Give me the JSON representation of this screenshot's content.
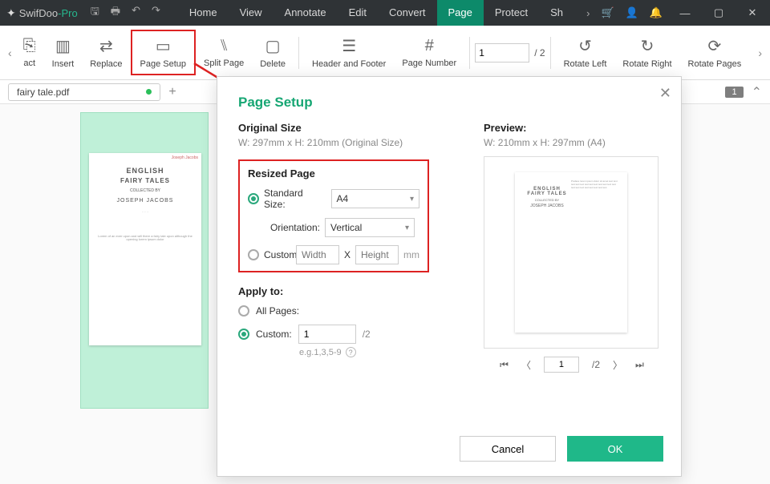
{
  "titlebar": {
    "brand1": "SwifDoo",
    "brand2": "-Pro"
  },
  "menu": {
    "home": "Home",
    "view": "View",
    "annotate": "Annotate",
    "edit": "Edit",
    "convert": "Convert",
    "page": "Page",
    "protect": "Protect",
    "share": "Sh"
  },
  "ribbon": {
    "extract": "act",
    "insert": "Insert",
    "replace": "Replace",
    "page_setup": "Page Setup",
    "split_page": "Split Page",
    "delete": "Delete",
    "hf": "Header and Footer",
    "page_number": "Page Number",
    "page_input": "1",
    "page_total": "/ 2",
    "rotate_left": "Rotate Left",
    "rotate_right": "Rotate Right",
    "rotate_pages": "Rotate Pages"
  },
  "tabs": {
    "file": "fairy tale.pdf",
    "badge": "1"
  },
  "thumb": {
    "t1": "ENGLISH",
    "t2": "FAIRY TALES",
    "t3": "COLLECTED BY",
    "t4": "JOSEPH JACOBS"
  },
  "dialog": {
    "title": "Page Setup",
    "orig_h": "Original Size",
    "orig_sub": "W: 297mm x H: 210mm (Original Size)",
    "resized_h": "Resized Page",
    "std_label": "Standard Size:",
    "std_value": "A4",
    "orient_label": "Orientation:",
    "orient_value": "Vertical",
    "custom_label": "Custom:",
    "w_ph": "Width",
    "x": "X",
    "h_ph": "Height",
    "mm": "mm",
    "apply_h": "Apply to:",
    "all_pages": "All Pages:",
    "custom_apply": "Custom:",
    "custom_val": "1",
    "custom_total": "/2",
    "hint": "e.g.1,3,5-9",
    "preview_h": "Preview:",
    "preview_sub": "W: 210mm x H: 297mm (A4)",
    "prev_page": "1",
    "prev_total": "/2",
    "cancel": "Cancel",
    "ok": "OK"
  }
}
